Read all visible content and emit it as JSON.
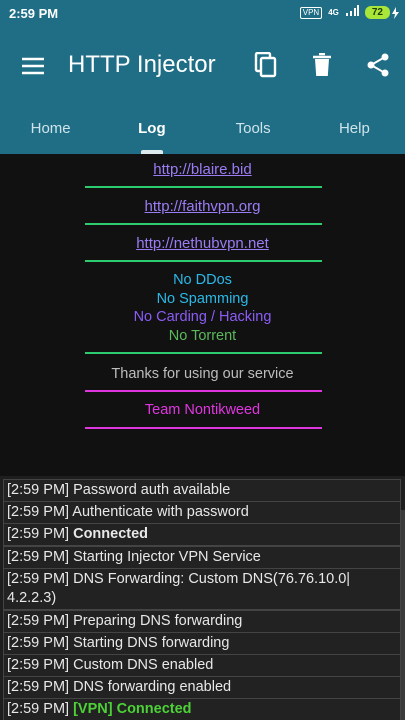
{
  "status_bar": {
    "time": "2:59 PM",
    "vpn": "VPN",
    "network": "4G",
    "battery": "72"
  },
  "toolbar": {
    "title": "HTTP Injector",
    "icons": [
      "menu-icon",
      "copy-icon",
      "trash-icon",
      "share-icon"
    ]
  },
  "tabs": [
    {
      "label": "Home"
    },
    {
      "label": "Log"
    },
    {
      "label": "Tools"
    },
    {
      "label": "Help"
    }
  ],
  "banner": {
    "links": [
      "http://blaire.bid",
      "http://faithvpn.org",
      "http://nethubvpn.net"
    ],
    "rules": [
      "No DDos",
      "No Spamming",
      "No Carding / Hacking",
      "No Torrent"
    ],
    "thanks": "Thanks for using our service",
    "team": "Team Nontikweed"
  },
  "log": [
    {
      "time": "[2:59 PM]",
      "text": "Password auth available"
    },
    {
      "time": "[2:59 PM]",
      "text": "Authenticate with password"
    },
    {
      "time": "[2:59 PM]",
      "text": "Connected"
    },
    {
      "time": "[2:59 PM]",
      "text": "Starting Injector VPN Service"
    },
    {
      "time": "[2:59 PM]",
      "text": "DNS Forwarding: Custom DNS(76.76.10.0|",
      "text2": "4.2.2.3)"
    },
    {
      "time": "[2:59 PM]",
      "text": "Preparing DNS forwarding"
    },
    {
      "time": "[2:59 PM]",
      "text": "Starting DNS forwarding"
    },
    {
      "time": "[2:59 PM]",
      "text": "Custom DNS enabled"
    },
    {
      "time": "[2:59 PM]",
      "text": "DNS forwarding enabled"
    },
    {
      "time": "[2:59 PM]",
      "text": "[VPN] Connected"
    }
  ],
  "colors": {
    "appbar": "#1f6e86",
    "link": "#9b7cf5",
    "green_rule": "#2ecc71",
    "magenta": "#e036e0",
    "cyan": "#2bb8e8",
    "success": "#4cd137"
  }
}
